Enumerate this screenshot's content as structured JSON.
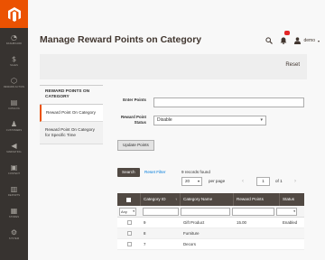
{
  "sidebar": {
    "items": [
      {
        "glyph": "◔",
        "label": "Dashboard",
        "icon": "dashboard-icon"
      },
      {
        "glyph": "$",
        "label": "Sales",
        "icon": "dollar-icon"
      },
      {
        "glyph": "⬡",
        "label": "Reward Action",
        "icon": "cube-icon"
      },
      {
        "glyph": "▤",
        "label": "Catalog",
        "icon": "catalog-icon"
      },
      {
        "glyph": "♟",
        "label": "Customers",
        "icon": "customer-icon"
      },
      {
        "glyph": "◀",
        "label": "Marketing",
        "icon": "megaphone-icon"
      },
      {
        "glyph": "▣",
        "label": "Content",
        "icon": "content-icon"
      },
      {
        "glyph": "▥",
        "label": "Reports",
        "icon": "bar-chart-icon"
      },
      {
        "glyph": "▦",
        "label": "Stores",
        "icon": "store-icon"
      },
      {
        "glyph": "⚙",
        "label": "System",
        "icon": "gear-icon"
      }
    ]
  },
  "header": {
    "title": "Manage Reward Points on Category",
    "user": "demo"
  },
  "action_bar": {
    "reset_label": "Reset"
  },
  "tabs": {
    "title": "REWARD POINTS ON CATEGORY",
    "items": [
      {
        "label": "Reward Point On Category"
      },
      {
        "label": "Reward Point On Category for Specific Time"
      }
    ]
  },
  "form": {
    "enter_points_label": "Enter Points",
    "status_label": "Reward Point Status",
    "status_value": "Disable",
    "update_label": "Update Points"
  },
  "grid": {
    "search_label": "Search",
    "reset_filter_label": "Reset Filter",
    "records_found": "9 records found",
    "per_page_value": "20",
    "per_page_label": "per page",
    "page_value": "1",
    "page_of": "of 1",
    "columns": [
      "Category ID",
      "Category Name",
      "Reward Points",
      "Status"
    ],
    "any_label": "Any",
    "rows": [
      {
        "id": "9",
        "name": "Gift Product",
        "points": "15.00",
        "status": "Enabled"
      },
      {
        "id": "8",
        "name": "Furniture",
        "points": "",
        "status": ""
      },
      {
        "id": "7",
        "name": "Decors",
        "points": "",
        "status": ""
      }
    ]
  },
  "colors": {
    "accent": "#eb5202",
    "sidebar": "#373330",
    "grid_header": "#514943",
    "link": "#007bdb"
  }
}
